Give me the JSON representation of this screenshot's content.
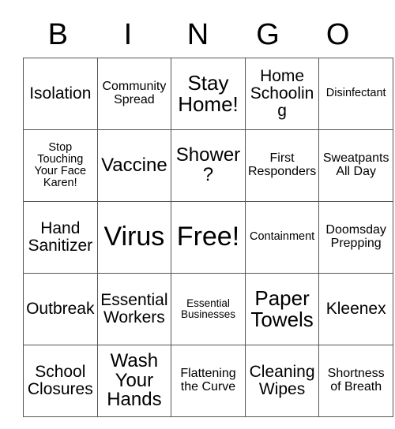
{
  "card": {
    "title": "BINGO",
    "header_letters": [
      "B",
      "I",
      "N",
      "G",
      "O"
    ],
    "free_space_label": "Free!",
    "border_color": "#555555",
    "background_color": "#ffffff",
    "text_color": "#000000",
    "rows": [
      [
        {
          "text": "Isolation",
          "size": "fs-m"
        },
        {
          "text": "Community Spread",
          "size": "fs-s"
        },
        {
          "text": "Stay Home!",
          "size": "fs-xl"
        },
        {
          "text": "Home Schooling",
          "size": "fs-m"
        },
        {
          "text": "Disinfectant",
          "size": "fs-xs"
        }
      ],
      [
        {
          "text": "Stop Touching Your Face Karen!",
          "size": "fs-xs"
        },
        {
          "text": "Vaccine",
          "size": "fs-l"
        },
        {
          "text": "Shower?",
          "size": "fs-l"
        },
        {
          "text": "First Responders",
          "size": "fs-s"
        },
        {
          "text": "Sweatpants All Day",
          "size": "fs-s"
        }
      ],
      [
        {
          "text": "Hand Sanitizer",
          "size": "fs-m"
        },
        {
          "text": "Virus",
          "size": "fs-xxl"
        },
        {
          "text": "Free!",
          "size": "fs-xxl"
        },
        {
          "text": "Containment",
          "size": "fs-xs"
        },
        {
          "text": "Doomsday Prepping",
          "size": "fs-s"
        }
      ],
      [
        {
          "text": "Outbreak",
          "size": "fs-m"
        },
        {
          "text": "Essential Workers",
          "size": "fs-m"
        },
        {
          "text": "Essential Businesses",
          "size": "fs-xxs"
        },
        {
          "text": "Paper Towels",
          "size": "fs-xl"
        },
        {
          "text": "Kleenex",
          "size": "fs-m"
        }
      ],
      [
        {
          "text": "School Closures",
          "size": "fs-m"
        },
        {
          "text": "Wash Your Hands",
          "size": "fs-l"
        },
        {
          "text": "Flattening the Curve",
          "size": "fs-s"
        },
        {
          "text": "Cleaning Wipes",
          "size": "fs-m"
        },
        {
          "text": "Shortness of Breath",
          "size": "fs-s"
        }
      ]
    ]
  }
}
